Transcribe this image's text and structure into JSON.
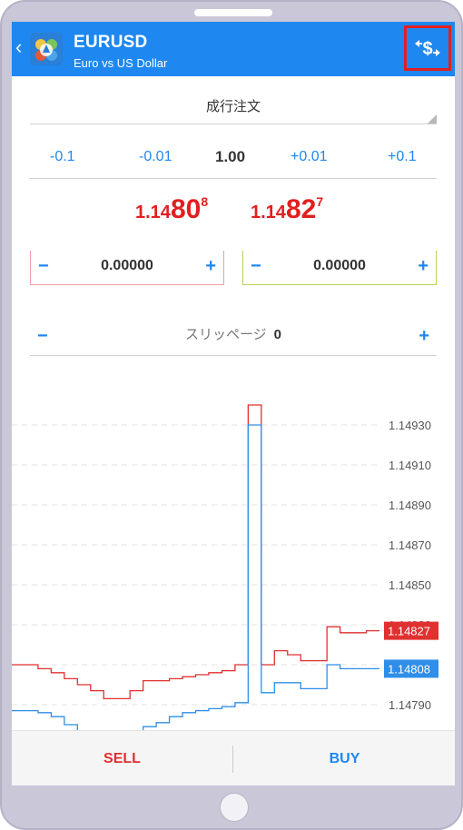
{
  "header": {
    "symbol": "EURUSD",
    "description": "Euro vs US Dollar",
    "back_icon": "chevron-left-icon",
    "quick_trade_icon": "one-click-trading-icon"
  },
  "order": {
    "type_label": "成行注文"
  },
  "volume": {
    "minus_big": "-0.1",
    "minus_small": "-0.01",
    "value": "1.00",
    "plus_small": "+0.01",
    "plus_big": "+0.1"
  },
  "prices": {
    "bid": {
      "small": "1.14",
      "big": "80",
      "sup": "8"
    },
    "ask": {
      "small": "1.14",
      "big": "82",
      "sup": "7"
    }
  },
  "stop_loss": {
    "minus": "−",
    "value": "0.00000",
    "plus": "+"
  },
  "take_profit": {
    "minus": "−",
    "value": "0.00000",
    "plus": "+"
  },
  "slippage": {
    "minus": "−",
    "label": "スリッページ",
    "value": "0",
    "plus": "+"
  },
  "chart_data": {
    "type": "line",
    "y_ticks": [
      "1.14930",
      "1.14910",
      "1.14890",
      "1.14870",
      "1.14850",
      "1.14830",
      "1.14810",
      "1.14790"
    ],
    "ylim": [
      1.1478,
      1.1494
    ],
    "series": [
      {
        "values": [
          1.1481,
          1.1481,
          1.14808,
          1.14806,
          1.14803,
          1.148,
          1.14797,
          1.14793,
          1.14793,
          1.14797,
          1.14802,
          1.14802,
          1.14803,
          1.14804,
          1.14805,
          1.14806,
          1.14807,
          1.1481,
          1.1494,
          1.1481,
          1.14817,
          1.14815,
          1.14812,
          1.14812,
          1.14829,
          1.14826,
          1.14826,
          1.14827,
          1.14827
        ],
        "color": "#e03030"
      },
      {
        "values": [
          1.14787,
          1.14787,
          1.14786,
          1.14784,
          1.1478,
          1.14777,
          1.14772,
          1.14769,
          1.14769,
          1.14773,
          1.14779,
          1.14781,
          1.14784,
          1.14786,
          1.14787,
          1.14788,
          1.14789,
          1.14791,
          1.1493,
          1.14796,
          1.14801,
          1.14801,
          1.14798,
          1.14798,
          1.1481,
          1.14808,
          1.14808,
          1.14808,
          1.14808
        ],
        "color": "#2e8ee8"
      }
    ],
    "price_labels": [
      {
        "text": "1.14827",
        "value": 1.14827,
        "color": "#e03030"
      },
      {
        "text": "1.14808",
        "value": 1.14808,
        "color": "#2e8ee8"
      }
    ],
    "grid": true
  },
  "bottom": {
    "sell_label": "SELL",
    "buy_label": "BUY"
  },
  "colors": {
    "accent": "#1e87f0",
    "sell": "#e03030",
    "sl_border": "#f0a0a0",
    "tp_border": "#b7d35a"
  }
}
